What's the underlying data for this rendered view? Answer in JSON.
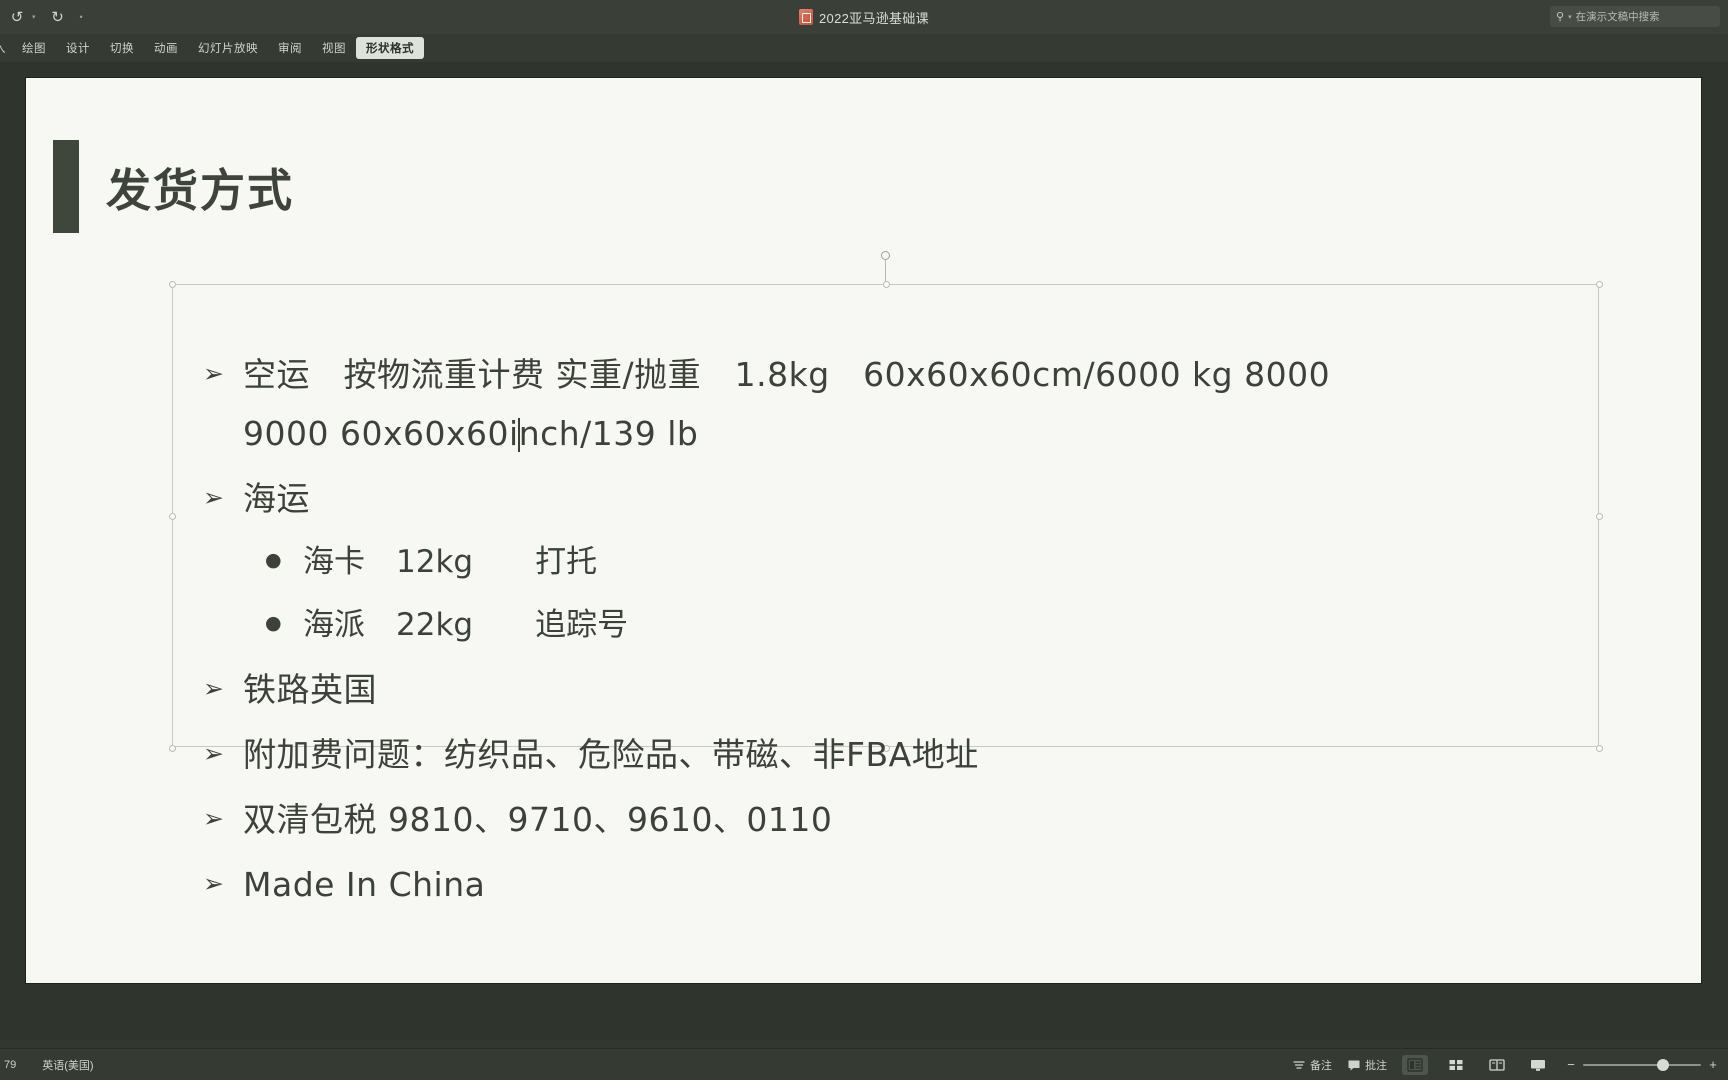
{
  "titlebar": {
    "document_title": "2022亚马逊基础课",
    "quick_access": [
      {
        "name": "undo",
        "glyph": "↺"
      },
      {
        "name": "undo-dropdown",
        "glyph": "▾"
      },
      {
        "name": "redo",
        "glyph": "↻"
      },
      {
        "name": "customize",
        "glyph": "•"
      }
    ],
    "search": {
      "placeholder": "在演示文稿中搜索",
      "icon": "search-icon",
      "caret": "▾"
    }
  },
  "ribbon": {
    "tabs": [
      {
        "label": "入",
        "active": false,
        "clipped": true
      },
      {
        "label": "绘图",
        "active": false
      },
      {
        "label": "设计",
        "active": false
      },
      {
        "label": "切换",
        "active": false
      },
      {
        "label": "动画",
        "active": false
      },
      {
        "label": "幻灯片放映",
        "active": false
      },
      {
        "label": "审阅",
        "active": false
      },
      {
        "label": "视图",
        "active": false
      },
      {
        "label": "形状格式",
        "active": true
      }
    ]
  },
  "slide": {
    "title": "发货方式",
    "body": [
      {
        "level": 1,
        "marker": "➢",
        "text": "空运　按物流重计费 实重/抛重　1.8kg　60x60x60cm/6000 kg  8000"
      },
      {
        "level": 1,
        "continuation": true,
        "text_before_caret": "9000        60x60x60i",
        "text_after_caret": "nch/139 lb"
      },
      {
        "level": 1,
        "marker": "➢",
        "text": "海运"
      },
      {
        "level": 2,
        "marker": "●",
        "text": "海卡　12kg　　打托"
      },
      {
        "level": 2,
        "marker": "●",
        "text": "海派　22kg　　追踪号"
      },
      {
        "level": 1,
        "marker": "➢",
        "text": "铁路英国"
      },
      {
        "level": 1,
        "marker": "➢",
        "text": "附加费问题：纺织品、危险品、带磁、非FBA地址"
      },
      {
        "level": 1,
        "marker": "➢",
        "text": "双清包税 9810、9710、9610、0110"
      },
      {
        "level": 1,
        "marker": "➢",
        "text": "Made In China"
      }
    ]
  },
  "statusbar": {
    "slide_number": "79",
    "language": "英语(美国)",
    "notes_label": "备注",
    "comments_label": "批注",
    "views": [
      {
        "name": "normal-view",
        "active": true
      },
      {
        "name": "slide-sorter-view",
        "active": false
      },
      {
        "name": "reading-view",
        "active": false
      },
      {
        "name": "slide-show-view",
        "active": false
      }
    ],
    "zoom_out": "−",
    "zoom_in": "+"
  }
}
